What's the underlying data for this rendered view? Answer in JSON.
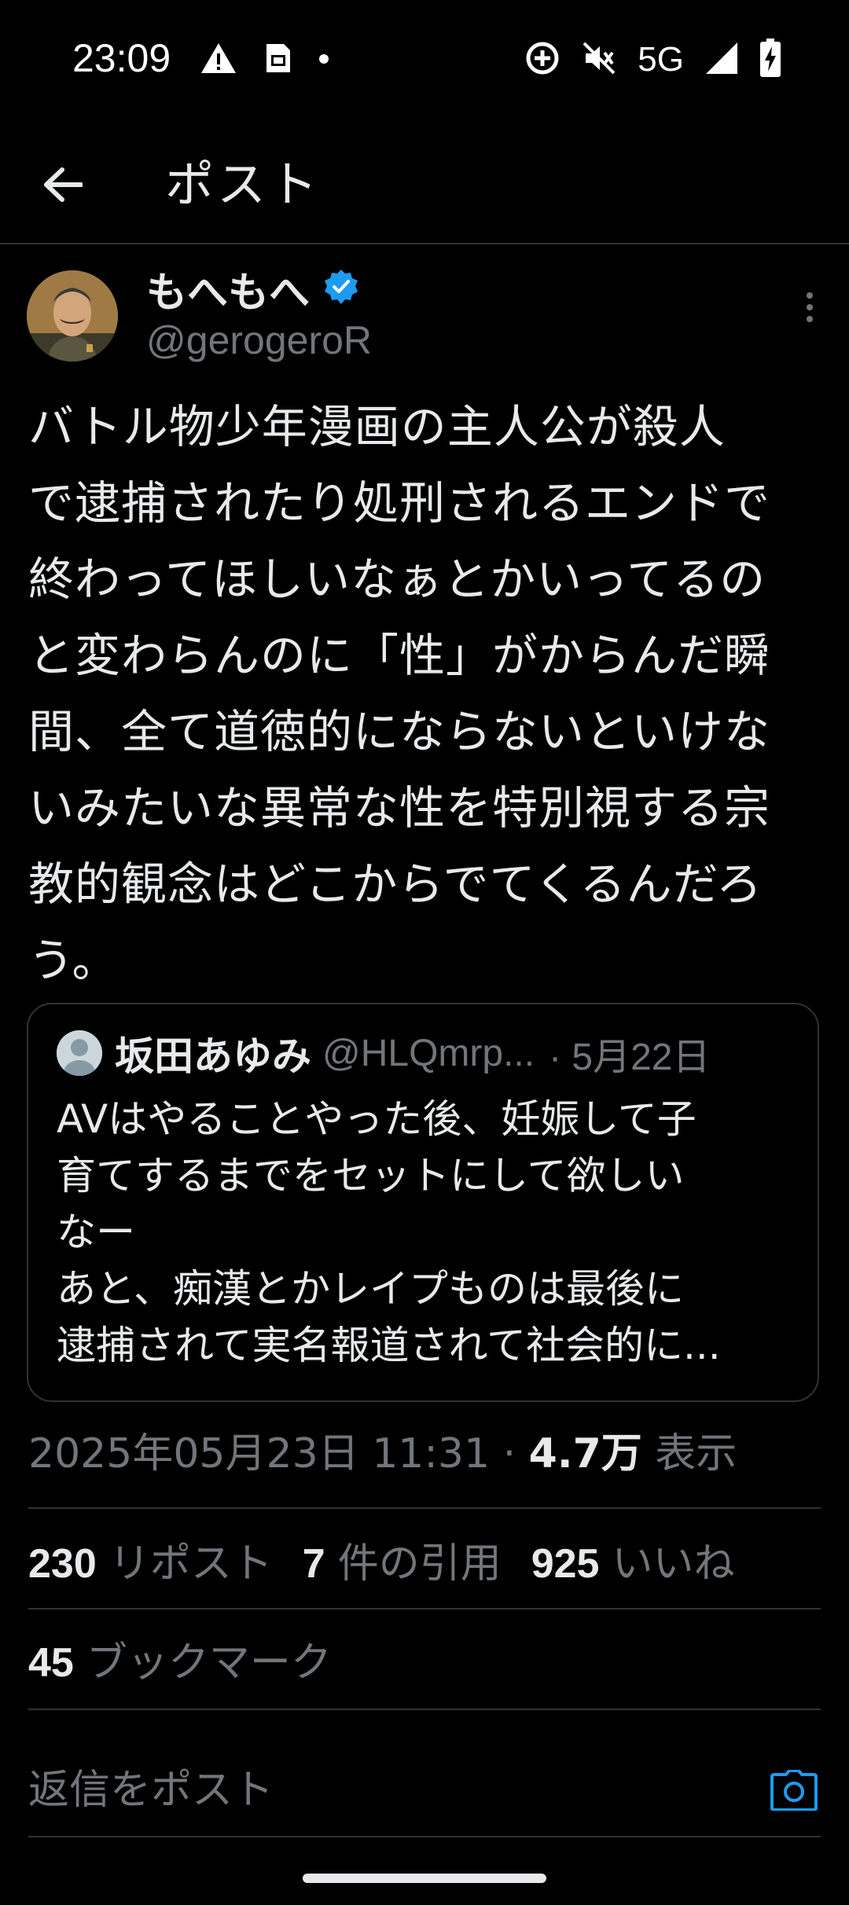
{
  "status_bar": {
    "time": "23:09",
    "network": "5G",
    "icons": [
      "warning-icon",
      "sim-card-icon",
      "notification-dot-icon",
      "data-saver-icon",
      "mute-icon",
      "signal-icon",
      "battery-charging-icon"
    ]
  },
  "header": {
    "title": "ポスト",
    "back_icon": "arrow-left-icon"
  },
  "author": {
    "name": "もへもへ",
    "handle": "@gerogeroR",
    "verified": true
  },
  "post": {
    "text": "バトル物少年漫画の主人公が殺人\nで逮捕されたり処刑されるエンドで\n終わってほしいなぁとかいってるの\nと変わらんのに「性」がからんだ瞬\n間、全て道徳的にならないといけな\nいみたいな異常な性を特別視する宗\n教的観念はどこからでてくるんだろ\nう。"
  },
  "quote": {
    "name": "坂田あゆみ",
    "handle": "@HLQmrp...",
    "date": "· 5月22日",
    "text": "AVはやることやった後、妊娠して子\n育てするまでをセットにして欲しい\nなー\nあと、痴漢とかレイプものは最後に\n逮捕されて実名報道されて社会的に..."
  },
  "meta": {
    "timestamp": "2025年05月23日 11:31 · ",
    "views_count": "4.7万",
    "views_label": " 表示"
  },
  "stats": {
    "reposts": {
      "count": "230",
      "label": "リポスト"
    },
    "quotes": {
      "count": "7",
      "label": "件の引用"
    },
    "likes": {
      "count": "925",
      "label": "いいね"
    },
    "bookmarks": {
      "count": "45",
      "label": "ブックマーク"
    }
  },
  "reply": {
    "placeholder": "返信をポスト",
    "camera_icon": "camera-icon"
  },
  "colors": {
    "background": "#000000",
    "text": "#e7e9ea",
    "muted": "#71767b",
    "divider": "#2f3336",
    "accent": "#1d9bf0"
  }
}
